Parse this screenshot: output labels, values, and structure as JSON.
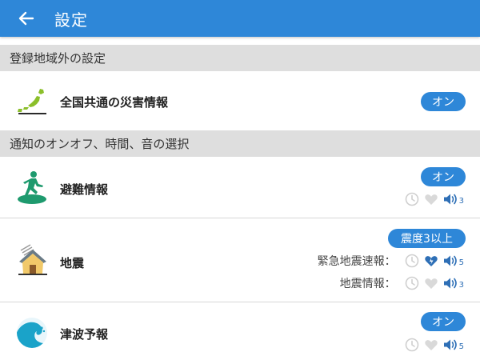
{
  "header": {
    "back_icon": "arrow-left-icon",
    "title": "設定"
  },
  "sections": {
    "outside_region": "登録地域外の設定",
    "notification": "通知のオンオフ、時間、音の選択"
  },
  "rows": {
    "common_disaster": {
      "label": "全国共通の災害情報",
      "icon": "japan-map-icon",
      "toggle": "オン"
    },
    "evacuation": {
      "label": "避難情報",
      "icon": "running-person-icon",
      "toggle": "オン",
      "volume": "3"
    },
    "earthquake": {
      "label": "地震",
      "icon": "house-earthquake-icon",
      "toggle": "震度3以上",
      "eew_label": "緊急地震速報：",
      "eew_volume": "5",
      "info_label": "地震情報：",
      "info_volume": "3"
    },
    "tsunami": {
      "label": "津波予報",
      "icon": "wave-icon",
      "toggle": "オン",
      "volume": "5"
    }
  },
  "colors": {
    "accent": "#2e87d8",
    "section_bg": "#dedede",
    "map_green": "#8bbf2a",
    "icon_green": "#1e9a6e"
  }
}
